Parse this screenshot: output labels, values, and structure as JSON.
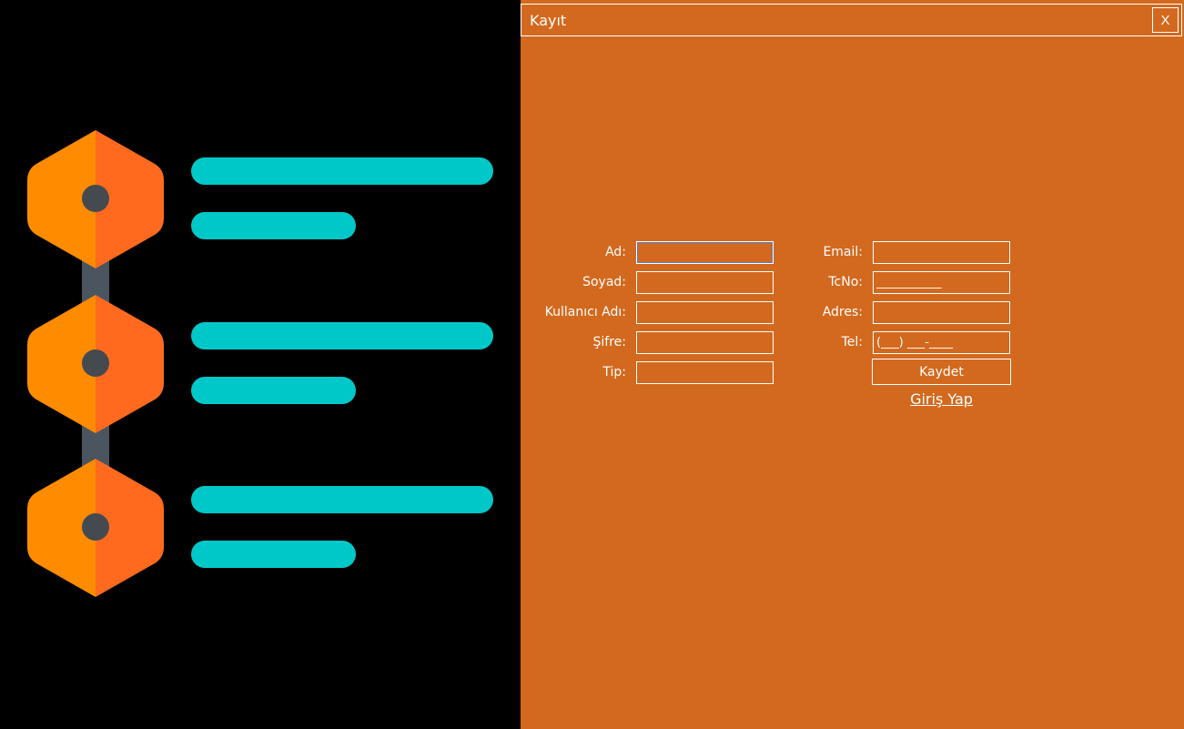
{
  "window": {
    "title": "Kayıt",
    "close_label": "X"
  },
  "form": {
    "left_fields": [
      {
        "label": "Ad:",
        "value": "",
        "placeholder": ""
      },
      {
        "label": "Soyad:",
        "value": "",
        "placeholder": ""
      },
      {
        "label": "Kullanıcı Adı:",
        "value": "",
        "placeholder": ""
      },
      {
        "label": "Şifre:",
        "value": "",
        "placeholder": ""
      },
      {
        "label": "Tip:",
        "value": "",
        "placeholder": ""
      }
    ],
    "right_fields": [
      {
        "label": "Email:",
        "value": "",
        "placeholder": ""
      },
      {
        "label": "TcNo:",
        "value": "",
        "placeholder": "___________"
      },
      {
        "label": "Adres:",
        "value": "",
        "placeholder": ""
      },
      {
        "label": "Tel:",
        "value": "",
        "placeholder": "(___) ___-____"
      }
    ],
    "save_label": "Kaydet",
    "login_link": "Giriş Yap"
  },
  "colors": {
    "panel_background": "#d2691e",
    "left_background": "#000000",
    "hexagon_light": "#ff8c00",
    "hexagon_dark": "#ff6a1e",
    "bar_color": "#00c8c8",
    "connector": "#4a5560"
  }
}
